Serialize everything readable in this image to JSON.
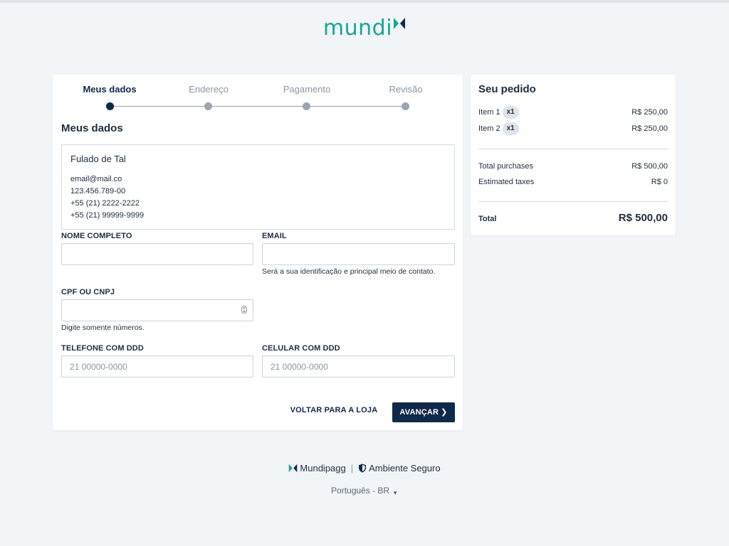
{
  "brand": {
    "logo_text": "mundi",
    "accent_color": "#1aa594",
    "dark_color": "#10284a"
  },
  "steps": [
    {
      "label": "Meus dados",
      "active": true
    },
    {
      "label": "Endereço",
      "active": false
    },
    {
      "label": "Pagamento",
      "active": false
    },
    {
      "label": "Revisão",
      "active": false
    }
  ],
  "form": {
    "section_title": "Meus dados",
    "summary": {
      "name": "Fulado de Tal",
      "email": "email@mail.co",
      "document": "123.456.789-00",
      "phone": "+55 (21) 2222-2222",
      "mobile": "+55 (21) 99999-9999"
    },
    "full_name": {
      "label": "NOME COMPLETO",
      "value": "",
      "placeholder": ""
    },
    "email": {
      "label": "EMAIL",
      "value": "",
      "placeholder": "",
      "help": "Será a sua identificação e principal meio de contato."
    },
    "document": {
      "label": "CPF OU CNPJ",
      "value": "",
      "placeholder": "",
      "help": "Digite somente números."
    },
    "phone": {
      "label": "TELEFONE COM DDD",
      "value": "",
      "placeholder": "21 00000-0000"
    },
    "mobile": {
      "label": "CELULAR COM DDD",
      "value": "",
      "placeholder": "21 00000-0000"
    },
    "back_label": "VOLTAR PARA A LOJA",
    "next_label": "AVANÇAR",
    "next_icon": "chevron-right-icon"
  },
  "order": {
    "title": "Seu pedido",
    "items": [
      {
        "name": "Item 1",
        "qty": "x1",
        "price": "R$ 250,00"
      },
      {
        "name": "Item 2",
        "qty": "x1",
        "price": "R$ 250,00"
      }
    ],
    "total_purchases_label": "Total purchases",
    "total_purchases_value": "R$ 500,00",
    "estimated_taxes_label": "Estimated taxes",
    "estimated_taxes_value": "R$ 0",
    "total_label": "Total",
    "total_value": "R$ 500,00"
  },
  "footer": {
    "brand_label": "Mundipagg",
    "brand_icon": "mundipagg-logo-icon",
    "secure_label": "Ambiente Seguro",
    "secure_icon": "shield-icon",
    "separator": "|",
    "language": "Português - BR",
    "language_icon": "caret-down-icon"
  }
}
